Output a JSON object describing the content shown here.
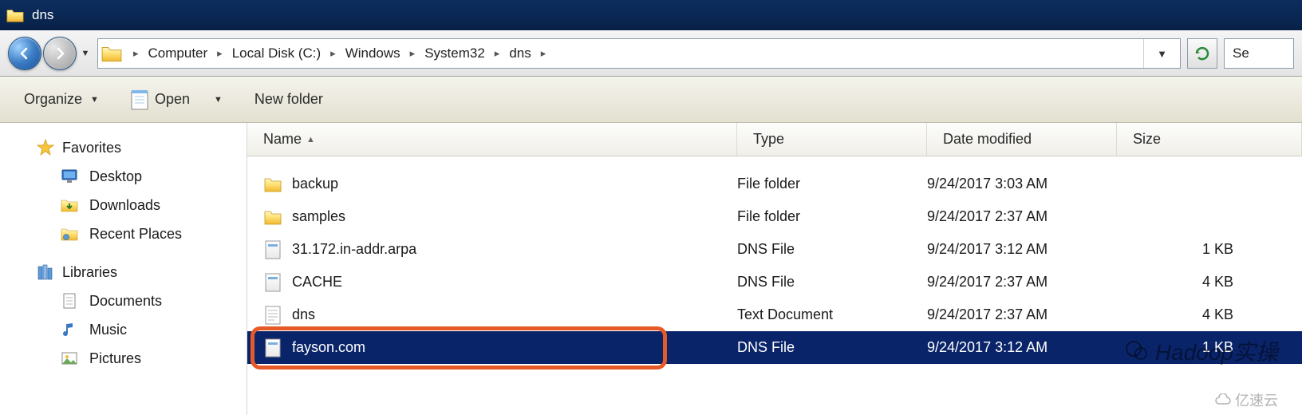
{
  "window": {
    "title": "dns"
  },
  "breadcrumbs": {
    "items": [
      "Computer",
      "Local Disk (C:)",
      "Windows",
      "System32",
      "dns"
    ]
  },
  "search": {
    "placeholder": "Se"
  },
  "toolbar": {
    "organize": "Organize",
    "open": "Open",
    "new_folder": "New folder"
  },
  "sidebar": {
    "favorites": {
      "label": "Favorites",
      "items": [
        {
          "label": "Desktop",
          "icon": "desktop-icon"
        },
        {
          "label": "Downloads",
          "icon": "downloads-icon"
        },
        {
          "label": "Recent Places",
          "icon": "recent-places-icon"
        }
      ]
    },
    "libraries": {
      "label": "Libraries",
      "items": [
        {
          "label": "Documents",
          "icon": "documents-icon"
        },
        {
          "label": "Music",
          "icon": "music-icon"
        },
        {
          "label": "Pictures",
          "icon": "pictures-icon"
        }
      ]
    }
  },
  "columns": {
    "name": "Name",
    "type": "Type",
    "date": "Date modified",
    "size": "Size"
  },
  "files": [
    {
      "name": "backup",
      "type": "File folder",
      "date": "9/24/2017 3:03 AM",
      "size": "",
      "icon": "folder-icon",
      "selected": false
    },
    {
      "name": "samples",
      "type": "File folder",
      "date": "9/24/2017 2:37 AM",
      "size": "",
      "icon": "folder-icon",
      "selected": false
    },
    {
      "name": "31.172.in-addr.arpa",
      "type": "DNS File",
      "date": "9/24/2017 3:12 AM",
      "size": "1 KB",
      "icon": "dns-file-icon",
      "selected": false
    },
    {
      "name": "CACHE",
      "type": "DNS File",
      "date": "9/24/2017 2:37 AM",
      "size": "4 KB",
      "icon": "dns-file-icon",
      "selected": false
    },
    {
      "name": "dns",
      "type": "Text Document",
      "date": "9/24/2017 2:37 AM",
      "size": "4 KB",
      "icon": "text-file-icon",
      "selected": false
    },
    {
      "name": "fayson.com",
      "type": "DNS File",
      "date": "9/24/2017 3:12 AM",
      "size": "1 KB",
      "icon": "dns-file-icon",
      "selected": true
    }
  ],
  "watermark": {
    "main": "Hadoop实操",
    "sub": "亿速云"
  }
}
